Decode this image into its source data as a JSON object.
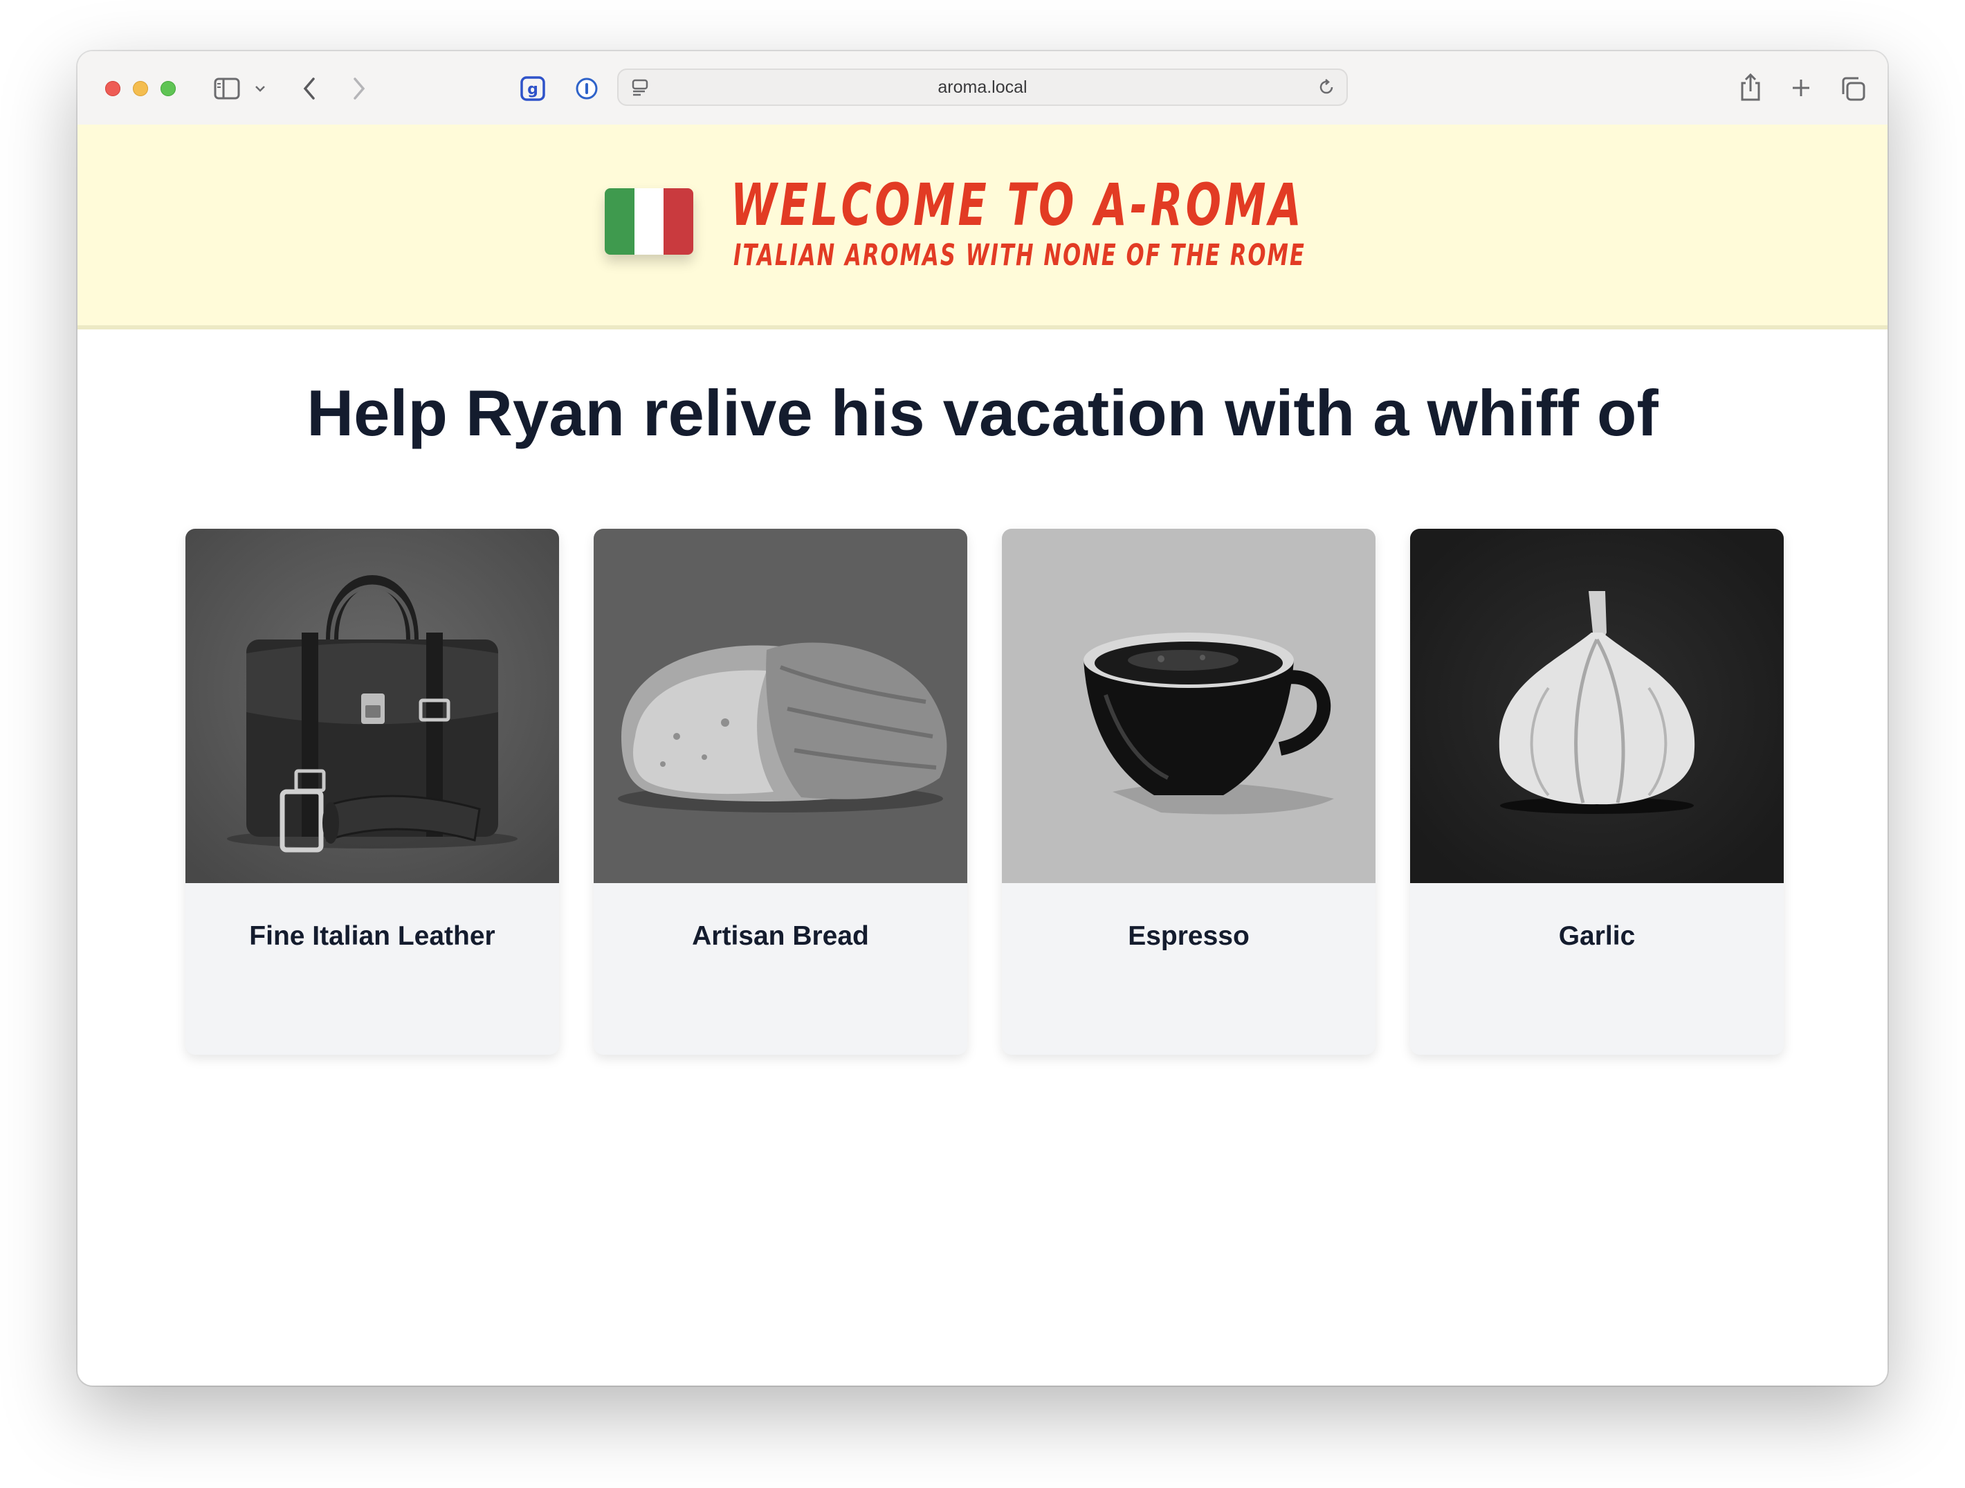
{
  "browser": {
    "url": "aroma.local",
    "toolbar_icons": [
      "sidebar-icon",
      "chevron-down-icon",
      "back-icon",
      "forward-icon",
      "extension-icon",
      "password-icon",
      "page-menu-icon",
      "reload-icon",
      "share-icon",
      "new-tab-icon",
      "tabs-overview-icon"
    ]
  },
  "hero": {
    "title": "WELCOME TO A-ROMA",
    "subtitle": "ITALIAN AROMAS WITH NONE OF THE ROME",
    "flag_colors": [
      "#3f9a4e",
      "#ffffff",
      "#c93a3e"
    ],
    "accent_color": "#e23b24",
    "background": "#fffbd9"
  },
  "main": {
    "heading": "Help Ryan relive his vacation with a whiff of",
    "cards": [
      {
        "label": "Fine Italian Leather",
        "image": "leather-bag-image"
      },
      {
        "label": "Artisan Bread",
        "image": "bread-image"
      },
      {
        "label": "Espresso",
        "image": "espresso-cup-image"
      },
      {
        "label": "Garlic",
        "image": "garlic-image"
      }
    ]
  }
}
